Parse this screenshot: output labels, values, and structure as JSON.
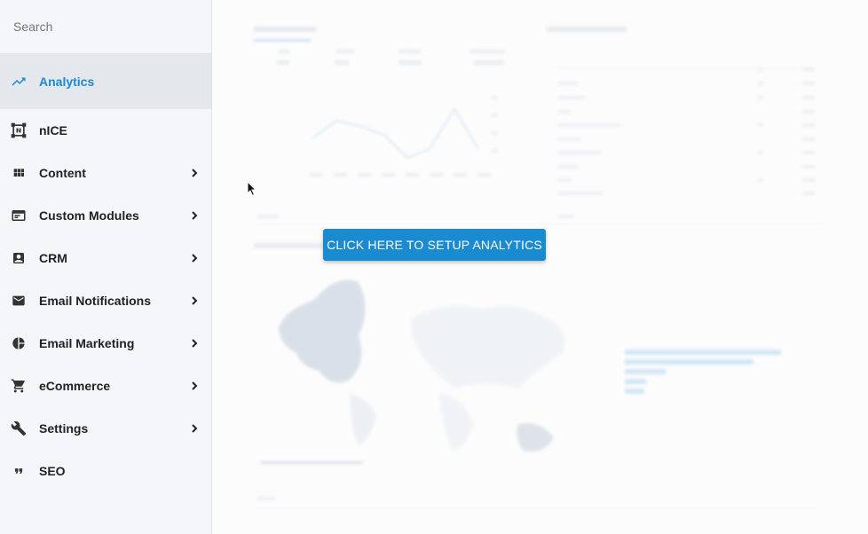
{
  "sidebar": {
    "search_placeholder": "Search",
    "items": [
      {
        "label": "Analytics",
        "icon": "trending-up-icon",
        "active": true,
        "has_submenu": false
      },
      {
        "label": "nICE",
        "icon": "nice-frame-icon",
        "active": false,
        "has_submenu": false
      },
      {
        "label": "Content",
        "icon": "grid-icon",
        "active": false,
        "has_submenu": true
      },
      {
        "label": "Custom Modules",
        "icon": "window-icon",
        "active": false,
        "has_submenu": true
      },
      {
        "label": "CRM",
        "icon": "contact-card-icon",
        "active": false,
        "has_submenu": true
      },
      {
        "label": "Email Notifications",
        "icon": "envelope-icon",
        "active": false,
        "has_submenu": true
      },
      {
        "label": "Email Marketing",
        "icon": "pie-chart-icon",
        "active": false,
        "has_submenu": true
      },
      {
        "label": "eCommerce",
        "icon": "cart-icon",
        "active": false,
        "has_submenu": true
      },
      {
        "label": "Settings",
        "icon": "wrench-icon",
        "active": false,
        "has_submenu": true
      },
      {
        "label": "SEO",
        "icon": "quote-icon",
        "active": false,
        "has_submenu": false
      }
    ]
  },
  "main": {
    "setup_button_label": "CLICK HERE TO SETUP ANALYTICS"
  },
  "colors": {
    "accent": "#1a8bd0",
    "sidebar_bg": "#f4f6fa",
    "active_bg": "#e4e7ec"
  }
}
